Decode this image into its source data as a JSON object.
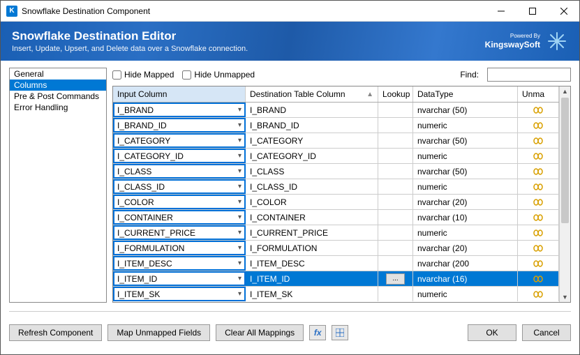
{
  "window": {
    "title": "Snowflake Destination Component",
    "app_icon_letter": "K"
  },
  "banner": {
    "heading": "Snowflake Destination Editor",
    "subtitle": "Insert, Update, Upsert, and Delete data over a Snowflake connection.",
    "powered_by": "Powered By",
    "brand": "KingswaySoft"
  },
  "sidebar": {
    "items": [
      "General",
      "Columns",
      "Pre & Post Commands",
      "Error Handling"
    ],
    "selected_index": 1
  },
  "toolbar": {
    "hide_mapped": "Hide Mapped",
    "hide_unmapped": "Hide Unmapped",
    "find_label": "Find:"
  },
  "grid": {
    "headers": {
      "input": "Input Column",
      "dest": "Destination Table Column",
      "lookup": "Lookup",
      "datatype": "DataType",
      "unmap": "Unma"
    },
    "rows": [
      {
        "input": "I_BRAND",
        "dest": "I_BRAND",
        "lookup": "",
        "datatype": "nvarchar (50)",
        "selected": false
      },
      {
        "input": "I_BRAND_ID",
        "dest": "I_BRAND_ID",
        "lookup": "",
        "datatype": "numeric",
        "selected": false
      },
      {
        "input": "I_CATEGORY",
        "dest": "I_CATEGORY",
        "lookup": "",
        "datatype": "nvarchar (50)",
        "selected": false
      },
      {
        "input": "I_CATEGORY_ID",
        "dest": "I_CATEGORY_ID",
        "lookup": "",
        "datatype": "numeric",
        "selected": false
      },
      {
        "input": "I_CLASS",
        "dest": "I_CLASS",
        "lookup": "",
        "datatype": "nvarchar (50)",
        "selected": false
      },
      {
        "input": "I_CLASS_ID",
        "dest": "I_CLASS_ID",
        "lookup": "",
        "datatype": "numeric",
        "selected": false
      },
      {
        "input": "I_COLOR",
        "dest": "I_COLOR",
        "lookup": "",
        "datatype": "nvarchar (20)",
        "selected": false
      },
      {
        "input": "I_CONTAINER",
        "dest": "I_CONTAINER",
        "lookup": "",
        "datatype": "nvarchar (10)",
        "selected": false
      },
      {
        "input": "I_CURRENT_PRICE",
        "dest": "I_CURRENT_PRICE",
        "lookup": "",
        "datatype": "numeric",
        "selected": false
      },
      {
        "input": "I_FORMULATION",
        "dest": "I_FORMULATION",
        "lookup": "",
        "datatype": "nvarchar (20)",
        "selected": false
      },
      {
        "input": "I_ITEM_DESC",
        "dest": "I_ITEM_DESC",
        "lookup": "",
        "datatype": "nvarchar (200",
        "selected": false
      },
      {
        "input": "I_ITEM_ID",
        "dest": "I_ITEM_ID",
        "lookup": "...",
        "datatype": "nvarchar (16)",
        "selected": true
      },
      {
        "input": "I_ITEM_SK",
        "dest": "I_ITEM_SK",
        "lookup": "",
        "datatype": "numeric",
        "selected": false
      }
    ]
  },
  "footer": {
    "refresh": "Refresh Component",
    "map_unmapped": "Map Unmapped Fields",
    "clear_all": "Clear All Mappings",
    "ok": "OK",
    "cancel": "Cancel"
  }
}
